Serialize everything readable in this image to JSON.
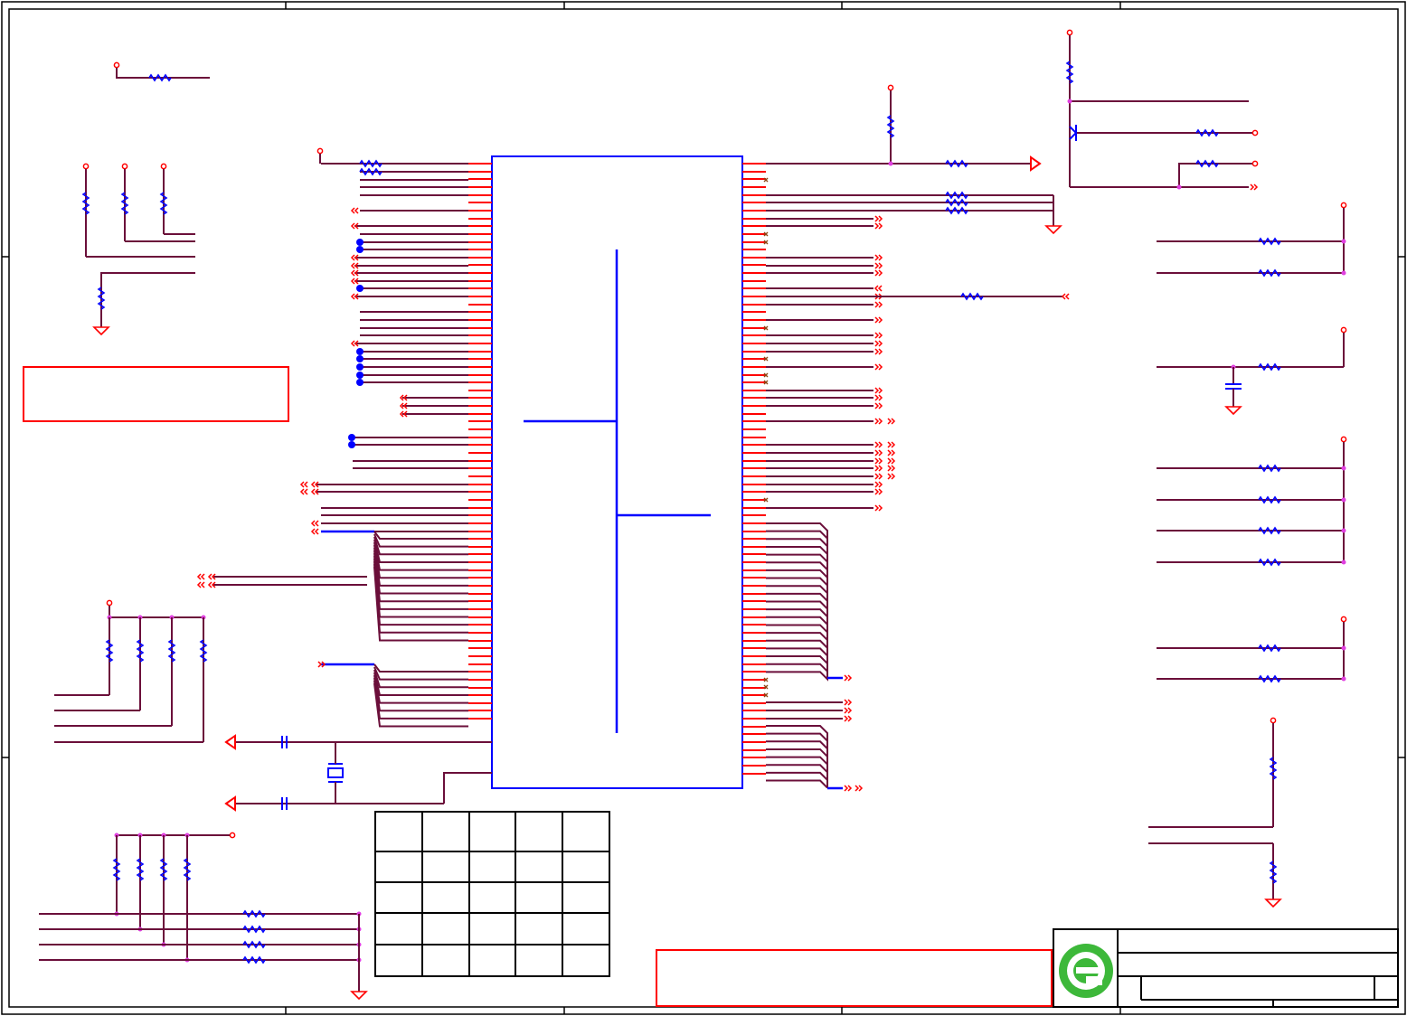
{
  "sheet": {
    "description_empty": true,
    "frame_color": "#000000",
    "wire_color": "#6b0f3a",
    "pin_color": "#ff0000",
    "component_color": "#0000ff",
    "junction_color": "#e040e0",
    "note_box_color": "#ff0000"
  },
  "main_ic": {
    "label": ""
  },
  "revision_table": {
    "rows": 5,
    "cols": 5
  },
  "title_block": {
    "logo": "e-logo-icon",
    "logo_color": "#3db83a"
  },
  "note_boxes": [
    {
      "name": "note-box-left",
      "text": ""
    },
    {
      "name": "note-box-bottom",
      "text": ""
    }
  ]
}
